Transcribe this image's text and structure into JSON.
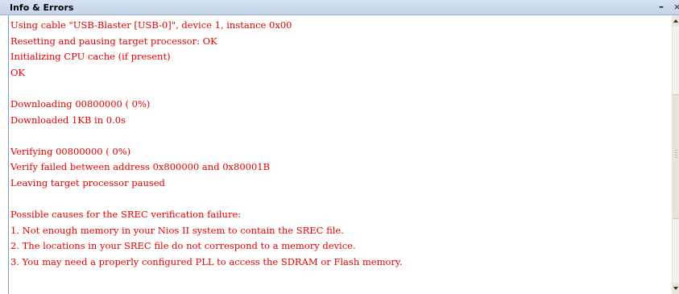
{
  "window": {
    "title": "Info & Errors",
    "minimize_label": "–",
    "close_label": "×"
  },
  "log": {
    "text_color": "#e60000",
    "lines": [
      "Using cable \"USB-Blaster [USB-0]\", device 1, instance 0x00",
      "Resetting and pausing target processor: OK",
      "Initializing CPU cache (if present)",
      "OK",
      "",
      "Downloading 00800000 ( 0%)",
      "Downloaded 1KB in 0.0s",
      "",
      "Verifying 00800000 ( 0%)",
      "Verify failed between address 0x800000 and 0x80001B",
      "Leaving target processor paused",
      "",
      "Possible causes for the SREC verification failure:",
      "1. Not enough memory in your Nios II system to contain the SREC file.",
      "2. The locations in your SREC file do not correspond to a memory device.",
      "3. You may need a properly configured PLL to access the SDRAM or Flash memory."
    ]
  },
  "scrollbar": {
    "up_icon": "scroll-up-arrow",
    "down_icon": "scroll-down-arrow"
  }
}
